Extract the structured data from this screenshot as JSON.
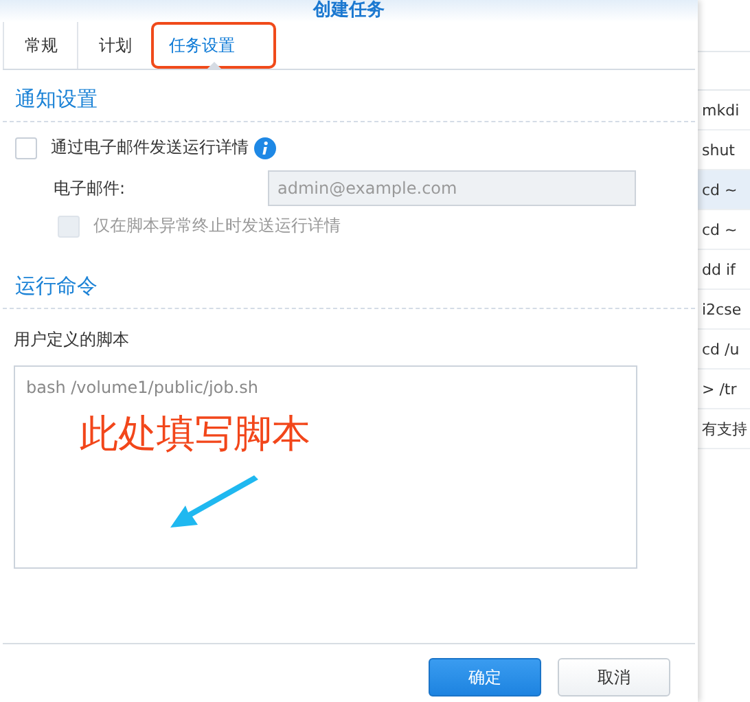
{
  "window": {
    "title": "创建任务"
  },
  "tabs": [
    {
      "label": "常规",
      "selected": false
    },
    {
      "label": "计划",
      "selected": false
    },
    {
      "label": "任务设置",
      "selected": true
    }
  ],
  "notification": {
    "heading": "通知设置",
    "email_details": {
      "label": "通过电子邮件发送运行详情",
      "checked": false
    },
    "email": {
      "label": "电子邮件:",
      "placeholder": "admin@example.com",
      "disabled": true
    },
    "only_on_error": {
      "label": "仅在脚本异常终止时发送运行详情",
      "checked": false,
      "disabled": true
    }
  },
  "command": {
    "heading": "运行命令",
    "script_label": "用户定义的脚本",
    "script_placeholder": "bash /volume1/public/job.sh"
  },
  "annotation": {
    "text": "此处填写脚本"
  },
  "buttons": [
    {
      "label": "确定",
      "kind": "primary"
    },
    {
      "label": "取消",
      "kind": "secondary"
    }
  ],
  "background_list": [
    {
      "text": "mkdi",
      "selected": false
    },
    {
      "text": "shut",
      "selected": false
    },
    {
      "text": "cd ~",
      "selected": true
    },
    {
      "text": "cd ~",
      "selected": false
    },
    {
      "text": "dd if",
      "selected": false
    },
    {
      "text": "i2cse",
      "selected": false
    },
    {
      "text": "cd /u",
      "selected": false
    },
    {
      "text": "> /tr",
      "selected": false
    },
    {
      "text": "有支持",
      "selected": false
    }
  ]
}
